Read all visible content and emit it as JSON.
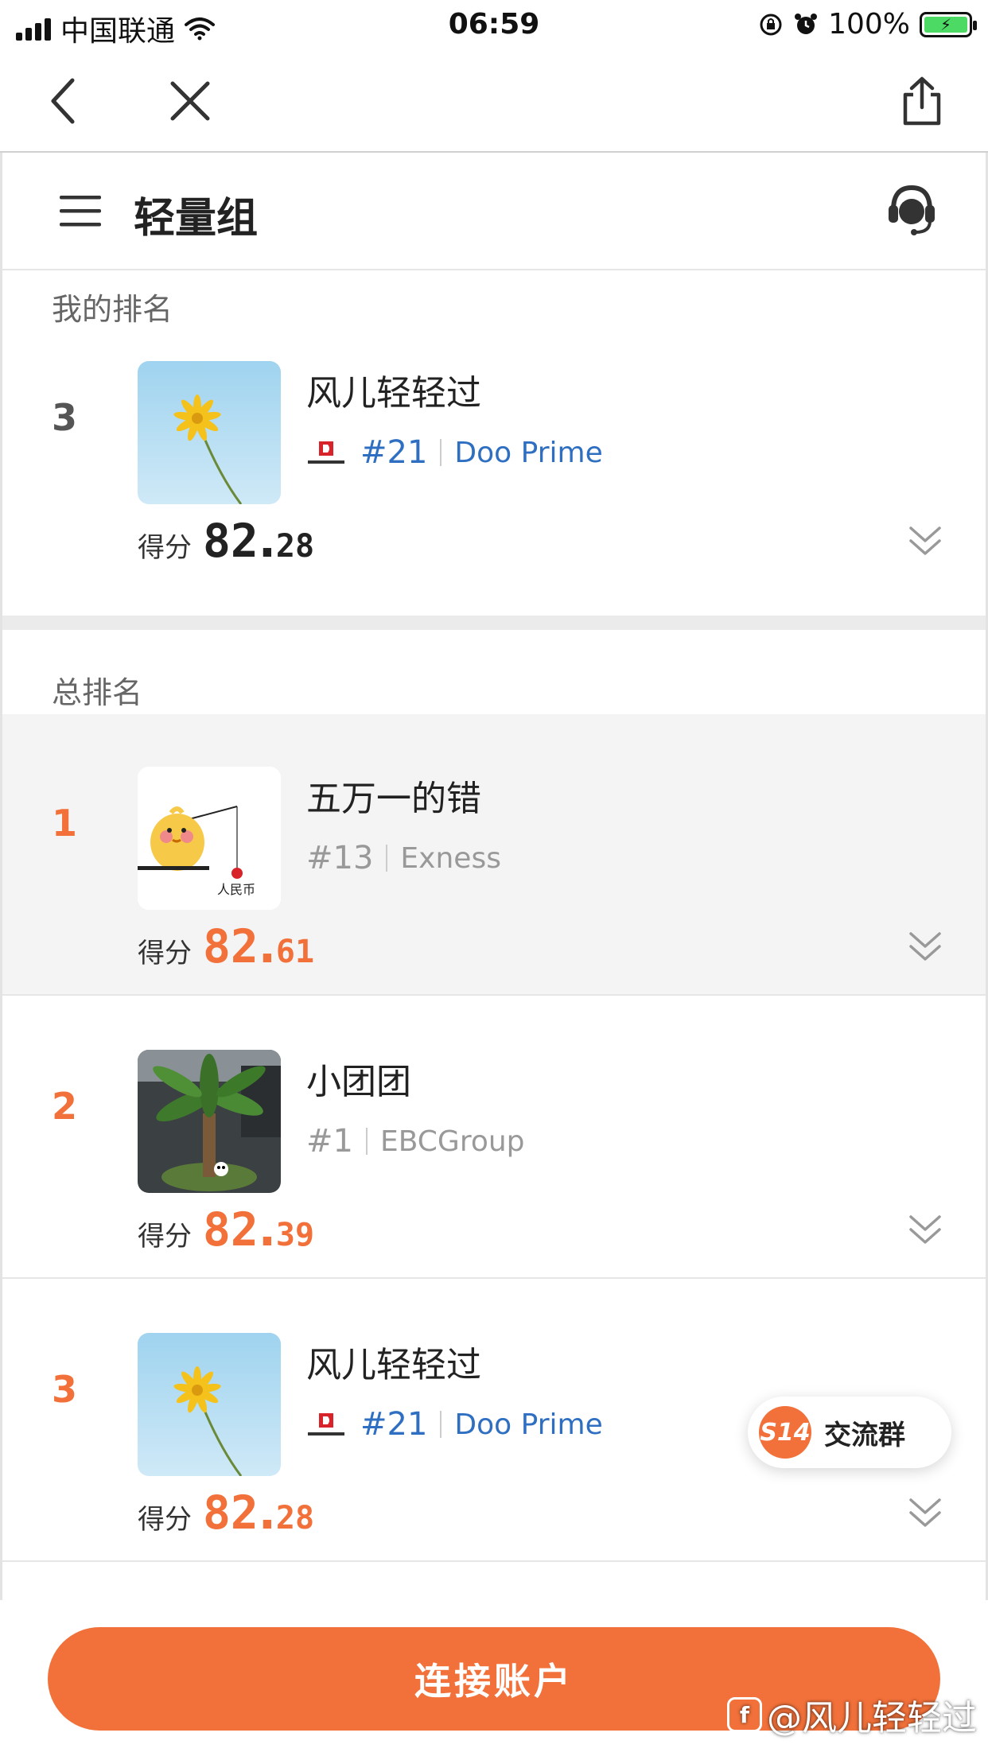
{
  "status_bar": {
    "carrier": "中国联通",
    "time": "06:59",
    "battery": "100%"
  },
  "nav": {
    "back_icon": "chevron-left-icon",
    "close_icon": "close-icon",
    "share_icon": "share-icon"
  },
  "header": {
    "title": "轻量组",
    "menu_icon": "hamburger-menu-icon",
    "support_icon": "customer-service-icon"
  },
  "my_rank": {
    "section_label": "我的排名",
    "rank": "3",
    "name": "风儿轻轻过",
    "number": "#21",
    "broker": "Doo Prime",
    "score_label": "得分",
    "score_int": "82",
    "score_dec": "28"
  },
  "overall": {
    "section_label": "总排名",
    "items": [
      {
        "rank": "1",
        "name": "五万一的错",
        "number": "#13",
        "broker": "Exness",
        "score_label": "得分",
        "score_int": "82",
        "score_dec": "61",
        "avatar_caption": "人民币"
      },
      {
        "rank": "2",
        "name": "小团团",
        "number": "#1",
        "broker": "EBCGroup",
        "score_label": "得分",
        "score_int": "82",
        "score_dec": "39"
      },
      {
        "rank": "3",
        "name": "风儿轻轻过",
        "number": "#21",
        "broker": "Doo Prime",
        "score_label": "得分",
        "score_int": "82",
        "score_dec": "28"
      }
    ]
  },
  "group_chat": {
    "badge": "S14",
    "label": "交流群"
  },
  "connect_button": "连接账户",
  "watermark": "@风儿轻轻过",
  "colors": {
    "accent": "#f2713a",
    "link_blue": "#2f6fc1",
    "highlight_row": "#f4f4f4"
  }
}
